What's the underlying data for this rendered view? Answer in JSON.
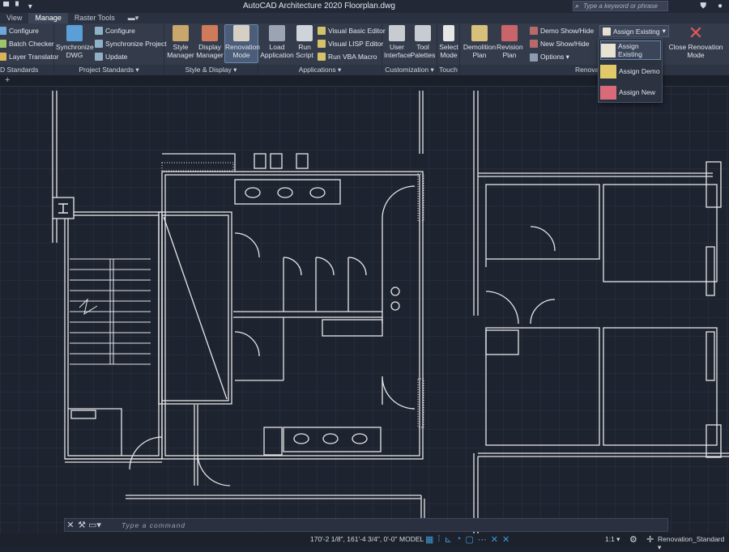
{
  "titlebar": {
    "title": "AutoCAD Architecture 2020   Floorplan.dwg",
    "search_placeholder": "Type a keyword or phrase"
  },
  "tabs": [
    "View",
    "Manage",
    "Raster Tools"
  ],
  "active_tab": "Manage",
  "ribbon": {
    "cad_standards": {
      "label": "D Standards",
      "items": [
        "Configure",
        "Batch Checker",
        "Layer Translator"
      ]
    },
    "project_standards": {
      "label": "Project Standards ▾",
      "sync_dwg": "Synchronize DWG",
      "items": [
        "Configure",
        "Synchronize Project",
        "Update"
      ]
    },
    "style_display": {
      "label": "Style & Display ▾",
      "buttons": [
        "Style Manager",
        "Display Manager",
        "Renovation Mode"
      ]
    },
    "applications": {
      "label": "Applications ▾",
      "buttons": [
        "Load Application",
        "Run Script"
      ],
      "items": [
        "Visual Basic Editor",
        "Visual LISP Editor",
        "Run VBA Macro"
      ]
    },
    "customization": {
      "label": "Customization ▾",
      "buttons": [
        "User Interface",
        "Tool Palettes"
      ]
    },
    "touch": {
      "label": "Touch",
      "button": "Select Mode"
    },
    "renovation": {
      "label": "Renova",
      "buttons": [
        "Demolition Plan",
        "Revision Plan"
      ],
      "items": [
        "Demo Show/Hide",
        "New Show/Hide",
        "Options ▾"
      ],
      "assign_label": "Assign Existing",
      "close": "Close Renovation Mode"
    }
  },
  "dropdown": {
    "items": [
      "Assign Existing",
      "Assign Demo",
      "Assign New"
    ],
    "selected": "Assign Existing"
  },
  "command": {
    "placeholder": "Type a command"
  },
  "status": {
    "coords": "170'-2 1/8\", 161'-4 3/4\", 0'-0\"",
    "model": "MODEL",
    "scale": "1:1 ▾",
    "style": "Renovation_Standard ▾"
  },
  "colors": {
    "accent": "#3f9bd9",
    "ribbon": "#343c4c",
    "canvas": "#1e2330",
    "lines": "#e6e6e6"
  }
}
